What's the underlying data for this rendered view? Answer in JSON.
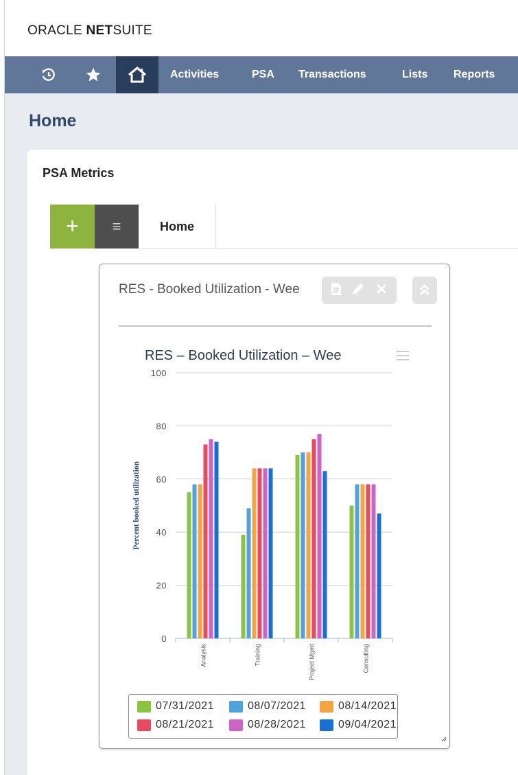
{
  "app": {
    "logo_oracle": "ORACLE",
    "logo_net": "NET",
    "logo_suite": "SUITE"
  },
  "nav": {
    "items": [
      "Activities",
      "PSA",
      "Transactions",
      "Lists",
      "Reports"
    ],
    "icons": [
      "recent-records-icon",
      "favorites-star-icon",
      "home-icon"
    ],
    "bar_color": "#607799",
    "active_color": "#293d5c"
  },
  "page": {
    "title": "Home"
  },
  "portlet": {
    "title": "PSA Metrics",
    "add_label": "+",
    "menu_label": "≡",
    "tab_label": "Home"
  },
  "widget": {
    "title": "RES - Booked Utilization - Wee"
  },
  "chart_data": {
    "type": "bar",
    "title": "RES – Booked Utilization – Wee",
    "ylabel": "Percent booked utilization",
    "xlabel": "",
    "ylim": [
      0,
      100
    ],
    "yticks": [
      0,
      20,
      40,
      60,
      80,
      100
    ],
    "categories": [
      "Analysis",
      "Training",
      "Project Mgmt",
      "Consulting"
    ],
    "grid": true,
    "legend_position": "bottom",
    "series": [
      {
        "name": "07/31/2021",
        "color": "#8bc53f",
        "values": [
          55,
          39,
          69,
          50
        ]
      },
      {
        "name": "08/07/2021",
        "color": "#4fa3de",
        "values": [
          58,
          49,
          70,
          58
        ]
      },
      {
        "name": "08/14/2021",
        "color": "#f5a441",
        "values": [
          58,
          64,
          70,
          58
        ]
      },
      {
        "name": "08/21/2021",
        "color": "#e84a5f",
        "values": [
          73,
          64,
          75,
          58
        ]
      },
      {
        "name": "08/28/2021",
        "color": "#cc63c9",
        "values": [
          75,
          64,
          77,
          58
        ]
      },
      {
        "name": "09/04/2021",
        "color": "#1670d6",
        "values": [
          74,
          64,
          63,
          47
        ]
      }
    ]
  }
}
